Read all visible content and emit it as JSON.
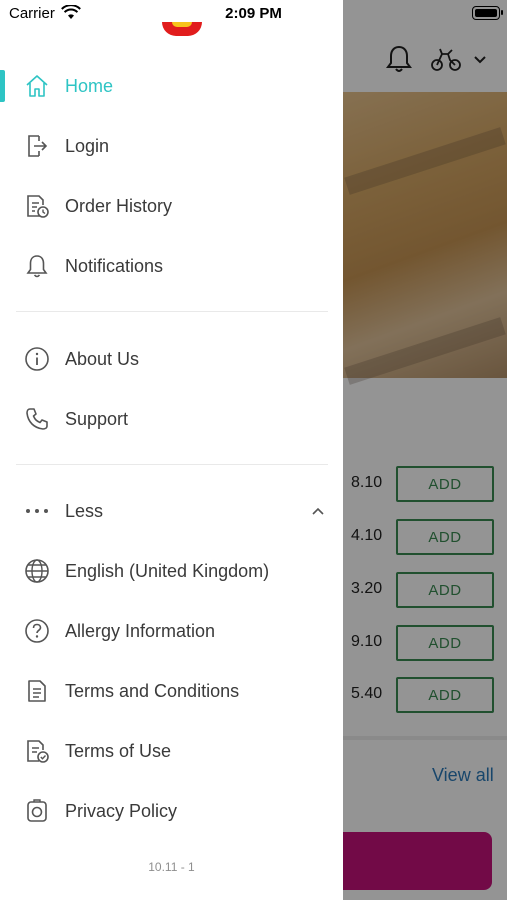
{
  "status_bar": {
    "carrier": "Carrier",
    "time": "2:09 PM"
  },
  "background": {
    "prices": [
      "8.10",
      "4.10",
      "3.20",
      "9.10",
      "5.40"
    ],
    "add_label": "ADD",
    "view_all": "View all"
  },
  "drawer": {
    "items": [
      {
        "label": "Home",
        "icon": "home-icon",
        "active": true
      },
      {
        "label": "Login",
        "icon": "login-icon"
      },
      {
        "label": "Order History",
        "icon": "order-history-icon"
      },
      {
        "label": "Notifications",
        "icon": "bell-icon"
      },
      {
        "label": "About Us",
        "icon": "info-icon"
      },
      {
        "label": "Support",
        "icon": "phone-icon"
      },
      {
        "label": "Less",
        "icon": "more-dots-icon"
      },
      {
        "label": "English (United Kingdom)",
        "icon": "globe-icon"
      },
      {
        "label": "Allergy Information",
        "icon": "question-icon"
      },
      {
        "label": "Terms and Conditions",
        "icon": "document-icon"
      },
      {
        "label": "Terms of Use",
        "icon": "document-check-icon"
      },
      {
        "label": "Privacy Policy",
        "icon": "privacy-icon"
      }
    ],
    "version": "10.11 - 1"
  },
  "colors": {
    "accent": "#2ec4c4",
    "add_green": "#3a8a52",
    "cta": "#c4127a",
    "link": "#2a79b8"
  }
}
